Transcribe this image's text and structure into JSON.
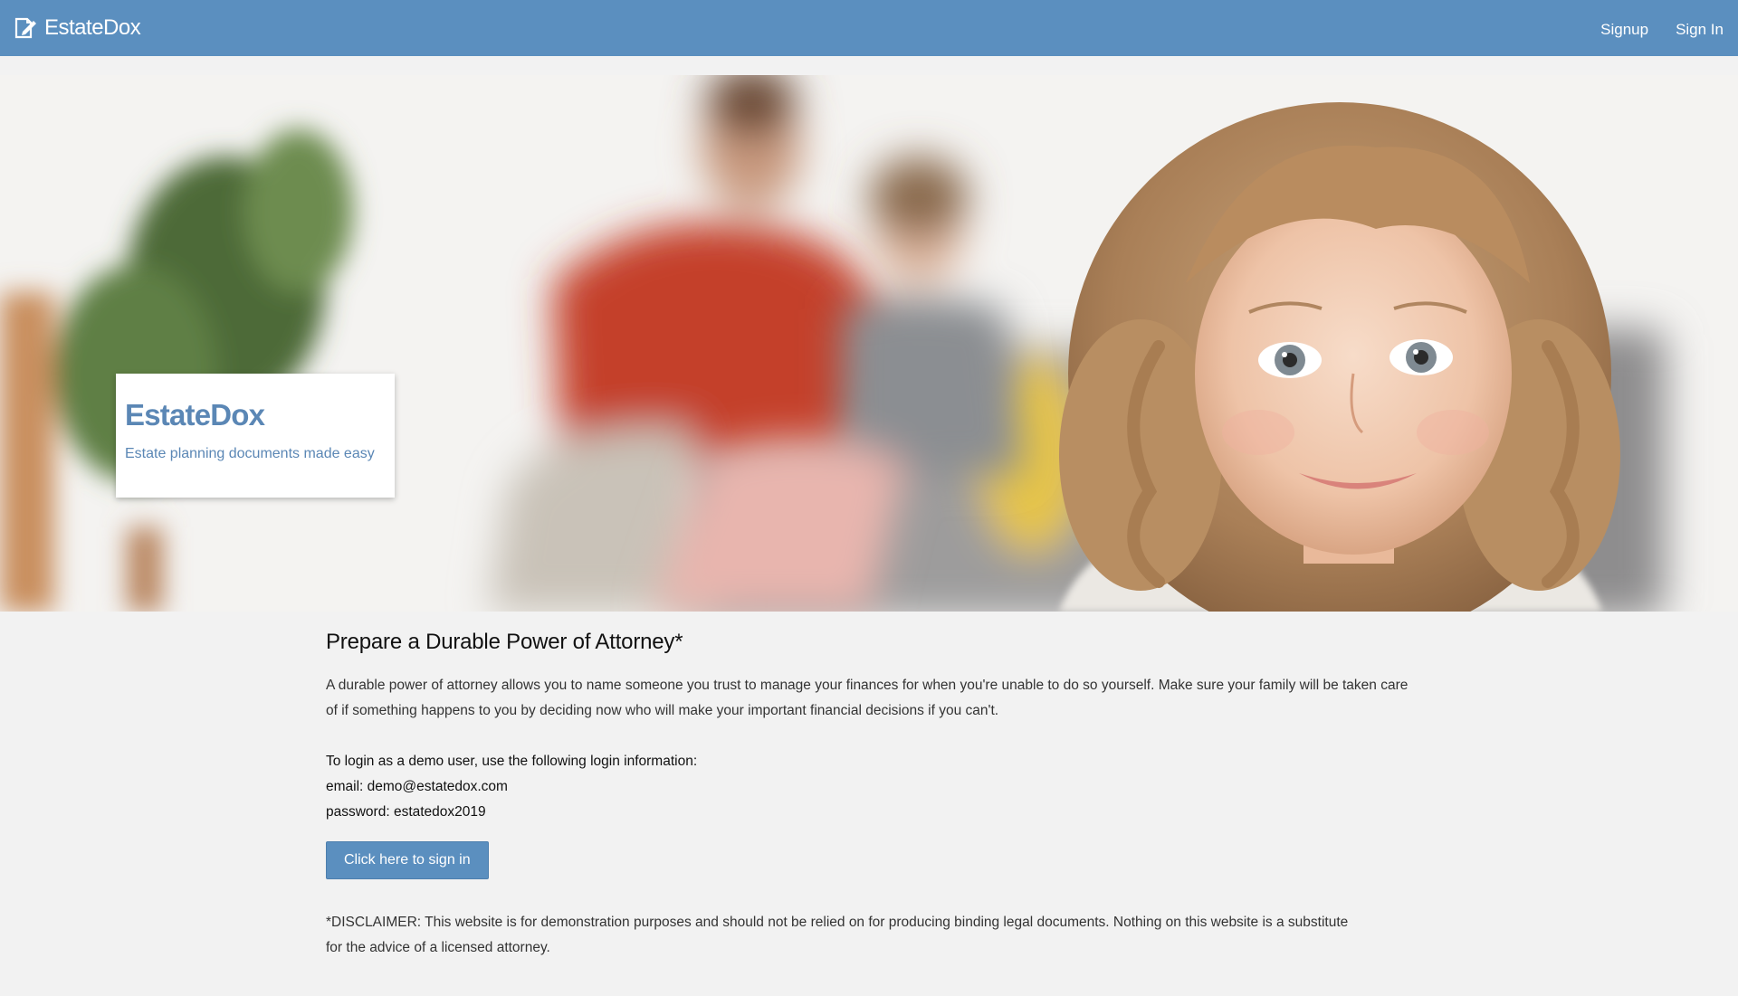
{
  "colors": {
    "navbar": "#5b8fbf",
    "accent_text": "#5b87b5",
    "background": "#f2f2f2",
    "button": "#5b8fbf"
  },
  "navbar": {
    "brand": "EstateDox",
    "brand_icon": "document-edit-icon",
    "links": [
      {
        "label": "Signup"
      },
      {
        "label": "Sign In"
      }
    ]
  },
  "hero": {
    "image": "family-photo-child-foreground",
    "card": {
      "title": "EstateDox",
      "tagline": "Estate planning documents made easy"
    }
  },
  "main": {
    "heading": "Prepare a Durable Power of Attorney*",
    "intro": "A durable power of attorney allows you to name someone you trust to manage your finances for when you're unable to do so yourself. Make sure your family will be taken care of if something happens to you by deciding now who will make your important financial decisions if you can't.",
    "demo": {
      "instructions": "To login as a demo user, use the following login information:",
      "email_line": "email: demo@estatedox.com",
      "password_line": "password: estatedox2019"
    },
    "signin_button": "Click here to sign in",
    "disclaimer": "*DISCLAIMER: This website is for demonstration purposes and should not be relied on for producing binding legal documents. Nothing on this website is a substitute for the advice of a licensed attorney."
  }
}
